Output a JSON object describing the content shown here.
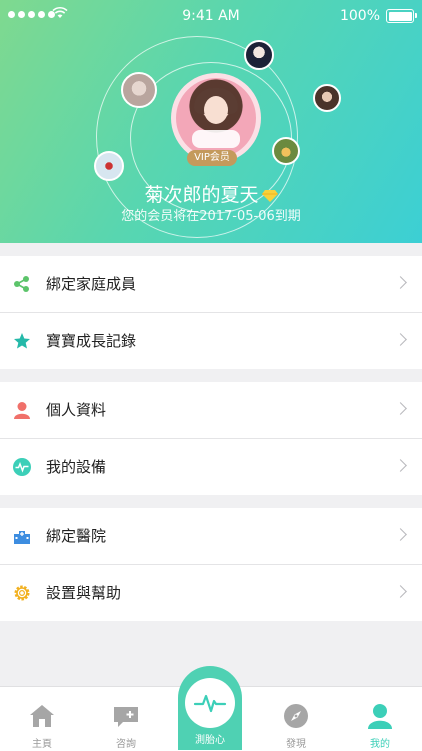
{
  "status_bar": {
    "time": "9:41 AM",
    "battery": "100%"
  },
  "profile": {
    "badge": "VIP会员",
    "name": "菊次郎的夏天",
    "membership_note": "您的会员将在2017-05-06到期"
  },
  "menu_groups": [
    [
      {
        "label": "綁定家庭成員",
        "icon": "share-icon"
      },
      {
        "label": "寶寶成長記錄",
        "icon": "star-icon"
      }
    ],
    [
      {
        "label": "個人資料",
        "icon": "person-icon"
      },
      {
        "label": "我的設備",
        "icon": "pulse-icon"
      }
    ],
    [
      {
        "label": "綁定醫院",
        "icon": "hospital-icon"
      },
      {
        "label": "設置與幫助",
        "icon": "gear-icon"
      }
    ]
  ],
  "tabs": [
    {
      "label": "主頁",
      "icon": "home-icon",
      "active": false
    },
    {
      "label": "咨詢",
      "icon": "chat-icon",
      "active": false
    },
    {
      "label": "測胎心",
      "icon": "heartbeat-icon",
      "active": false
    },
    {
      "label": "發現",
      "icon": "compass-icon",
      "active": false
    },
    {
      "label": "我的",
      "icon": "user-icon",
      "active": true
    }
  ],
  "colors": {
    "accent": "#4fd1b3",
    "header_start": "#7fd98f",
    "header_end": "#3ccfd4"
  }
}
